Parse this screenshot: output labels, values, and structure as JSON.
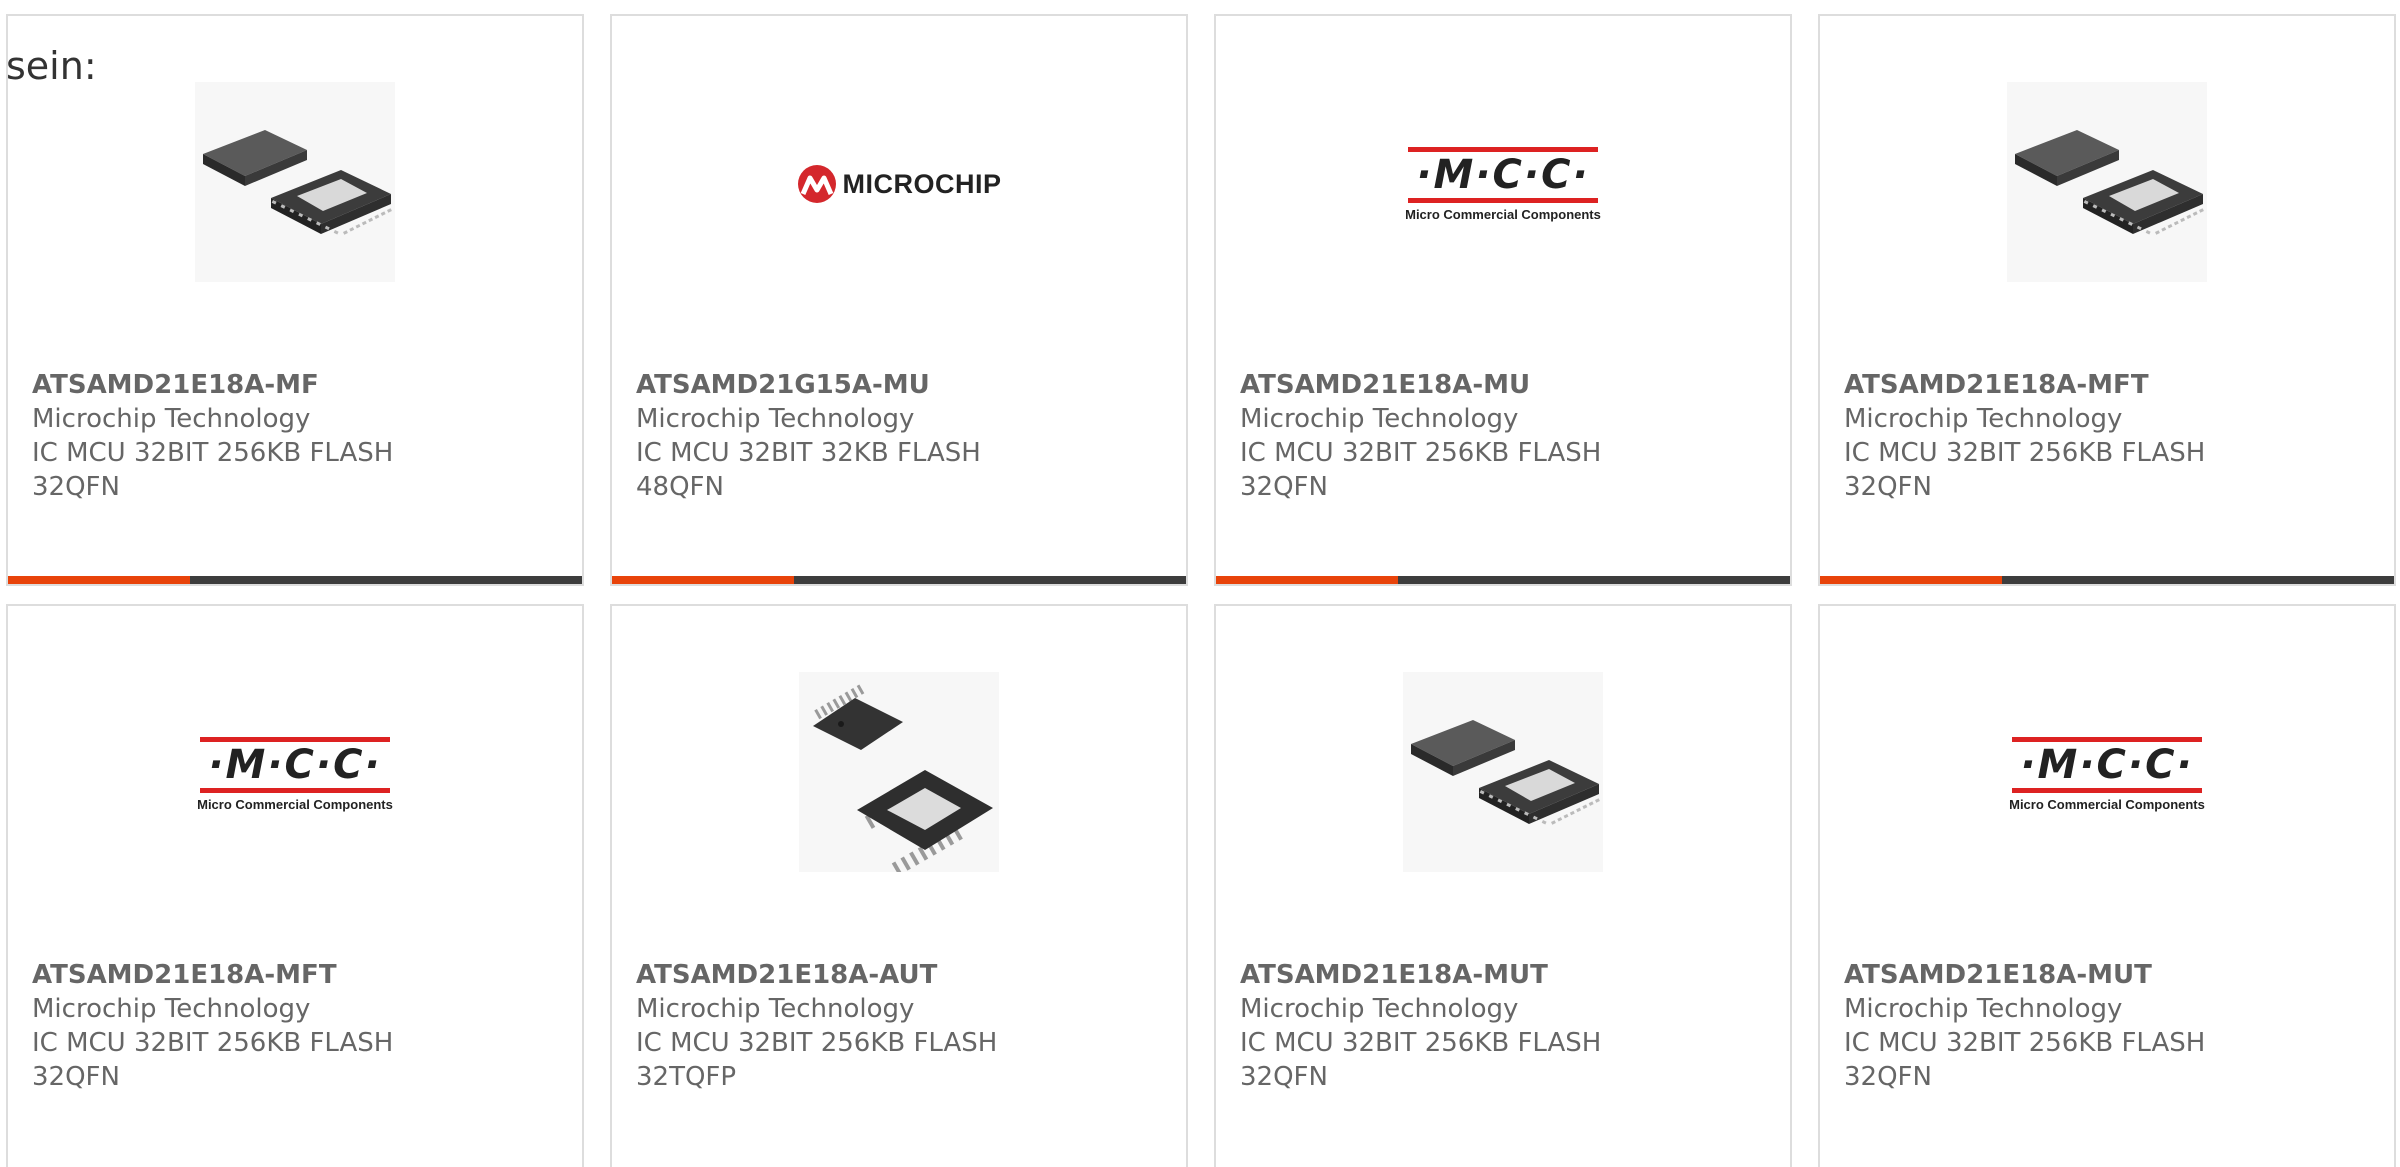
{
  "intro_text": "sein:",
  "colors": {
    "accent": "#e8430a",
    "bar_dark": "#3d3d3d",
    "logo_red": "#dd2222",
    "text_gray": "#666666"
  },
  "logos": {
    "microchip_word": "MICROCHIP",
    "mcc_letters": "·M·C·C·",
    "mcc_sub": "Micro Commercial Components"
  },
  "products": [
    {
      "part_number": "ATSAMD21E18A-MF",
      "manufacturer": "Microchip Technology",
      "desc_line1": "IC MCU 32BIT 256KB FLASH",
      "desc_line2": "32QFN",
      "image": "qfn-chip-icon"
    },
    {
      "part_number": "ATSAMD21G15A-MU",
      "manufacturer": "Microchip Technology",
      "desc_line1": "IC MCU 32BIT 32KB FLASH",
      "desc_line2": "48QFN",
      "image": "microchip-logo"
    },
    {
      "part_number": "ATSAMD21E18A-MU",
      "manufacturer": "Microchip Technology",
      "desc_line1": "IC MCU 32BIT 256KB FLASH",
      "desc_line2": "32QFN",
      "image": "mcc-logo"
    },
    {
      "part_number": "ATSAMD21E18A-MFT",
      "manufacturer": "Microchip Technology",
      "desc_line1": "IC MCU 32BIT 256KB FLASH",
      "desc_line2": "32QFN",
      "image": "qfn-chip-icon"
    },
    {
      "part_number": "ATSAMD21E18A-MFT",
      "manufacturer": "Microchip Technology",
      "desc_line1": "IC MCU 32BIT 256KB FLASH",
      "desc_line2": "32QFN",
      "image": "mcc-logo"
    },
    {
      "part_number": "ATSAMD21E18A-AUT",
      "manufacturer": "Microchip Technology",
      "desc_line1": "IC MCU 32BIT 256KB FLASH",
      "desc_line2": "32TQFP",
      "image": "tqfp-chip-icon"
    },
    {
      "part_number": "ATSAMD21E18A-MUT",
      "manufacturer": "Microchip Technology",
      "desc_line1": "IC MCU 32BIT 256KB FLASH",
      "desc_line2": "32QFN",
      "image": "qfn-chip-icon"
    },
    {
      "part_number": "ATSAMD21E18A-MUT",
      "manufacturer": "Microchip Technology",
      "desc_line1": "IC MCU 32BIT 256KB FLASH",
      "desc_line2": "32QFN",
      "image": "mcc-logo"
    }
  ]
}
